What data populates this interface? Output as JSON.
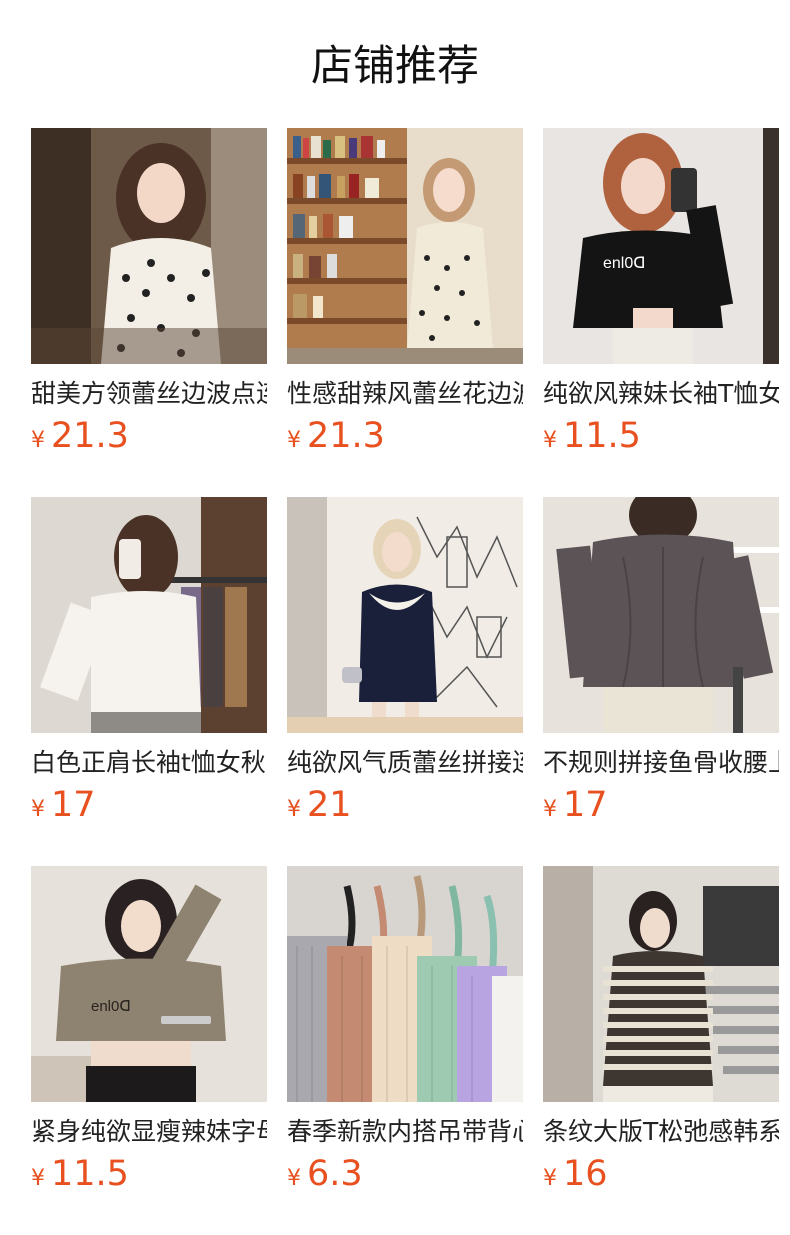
{
  "header": {
    "title": "店铺推荐"
  },
  "products": [
    {
      "title": "甜美方领蕾丝边波点连衣裙",
      "currency": "¥",
      "price": "21.3",
      "image": "polka-dot-dress-photo"
    },
    {
      "title": "性感甜辣风蕾丝花边波点裙",
      "currency": "¥",
      "price": "21.3",
      "image": "polka-dot-dress-bookshelf-photo"
    },
    {
      "title": "纯欲风辣妹长袖T恤女",
      "currency": "¥",
      "price": "11.5",
      "image": "black-crop-top-photo"
    },
    {
      "title": "白色正肩长袖t恤女秋",
      "currency": "¥",
      "price": "17",
      "image": "white-long-sleeve-photo"
    },
    {
      "title": "纯欲风气质蕾丝拼接连衣裙",
      "currency": "¥",
      "price": "21",
      "image": "navy-lace-dress-photo"
    },
    {
      "title": "不规则拼接鱼骨收腰上衣",
      "currency": "¥",
      "price": "17",
      "image": "grey-fishbone-top-photo"
    },
    {
      "title": "紧身纯欲显瘦辣妹字母T恤",
      "currency": "¥",
      "price": "11.5",
      "image": "khaki-crop-top-photo"
    },
    {
      "title": "春季新款内搭吊带背心",
      "currency": "¥",
      "price": "6.3",
      "image": "camisole-stack-photo"
    },
    {
      "title": "条纹大版T松弛感韩系",
      "currency": "¥",
      "price": "16",
      "image": "striped-tee-photo"
    }
  ],
  "colors": {
    "price": "#e8501f",
    "title": "#222222"
  }
}
